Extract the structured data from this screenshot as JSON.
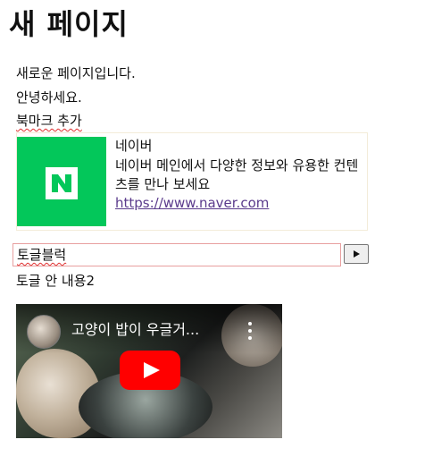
{
  "page": {
    "title": "새 페이지",
    "intro": "새로운 페이지입니다.",
    "greeting": "안녕하세요.",
    "bookmark_heading": "북마크 추가"
  },
  "bookmark": {
    "name": "네이버",
    "description": "네이버 메인에서 다양한 정보와 유용한 컨텐츠를 만나 보세요",
    "url": "https://www.naver.com",
    "logo_icon": "naver-n-logo",
    "brand_color": "#03c75a"
  },
  "toggle": {
    "label": "토글블럭",
    "content": "토글 안 내용2",
    "icon": "play-triangle-icon"
  },
  "video": {
    "title": "고양이 밥이 우글거...",
    "menu_icon": "more-vert-icon",
    "play_icon": "youtube-play-icon",
    "play_color": "#ff0000"
  }
}
